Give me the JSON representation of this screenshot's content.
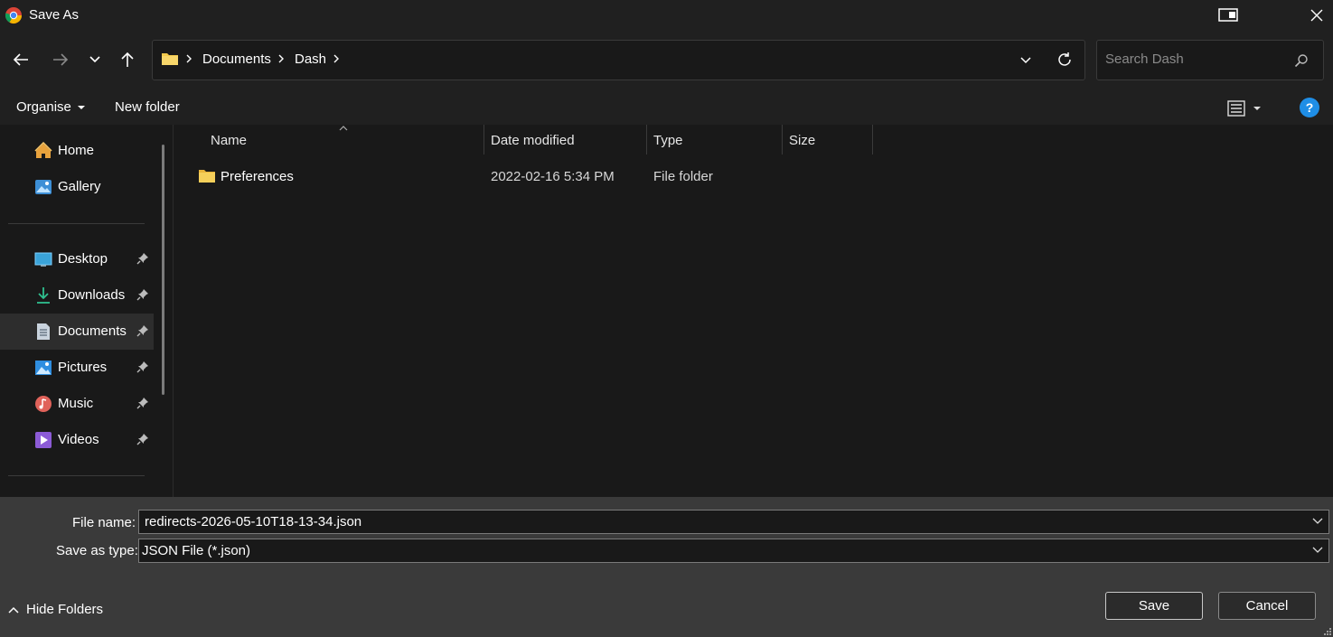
{
  "window": {
    "title": "Save As"
  },
  "address": {
    "crumbs": [
      "Documents",
      "Dash"
    ]
  },
  "search": {
    "placeholder": "Search Dash"
  },
  "commands": {
    "organise": "Organise",
    "new_folder": "New folder"
  },
  "sidebar": {
    "items": [
      {
        "label": "Home",
        "icon": "home-icon",
        "pinned": false
      },
      {
        "label": "Gallery",
        "icon": "gallery-icon",
        "pinned": false
      },
      {
        "label": "Desktop",
        "icon": "desktop-icon",
        "pinned": true
      },
      {
        "label": "Downloads",
        "icon": "downloads-icon",
        "pinned": true
      },
      {
        "label": "Documents",
        "icon": "documents-icon",
        "pinned": true,
        "selected": true
      },
      {
        "label": "Pictures",
        "icon": "pictures-icon",
        "pinned": true
      },
      {
        "label": "Music",
        "icon": "music-icon",
        "pinned": true
      },
      {
        "label": "Videos",
        "icon": "videos-icon",
        "pinned": true
      }
    ]
  },
  "filelist": {
    "columns": [
      "Name",
      "Date modified",
      "Type",
      "Size"
    ],
    "rows": [
      {
        "name": "Preferences",
        "date": "2022-02-16 5:34 PM",
        "type": "File folder",
        "size": ""
      }
    ]
  },
  "form": {
    "file_name_label": "File name:",
    "file_name": "redirects-2026-05-10T18-13-34.json",
    "save_type_label": "Save as type:",
    "save_type": "JSON File (*.json)"
  },
  "footer": {
    "hide_folders": "Hide Folders",
    "save": "Save",
    "cancel": "Cancel"
  },
  "colors": {
    "accent": "#1f8ee6",
    "folder": "#f2c94c",
    "background": "#191919",
    "panel": "#3a3a3a"
  }
}
